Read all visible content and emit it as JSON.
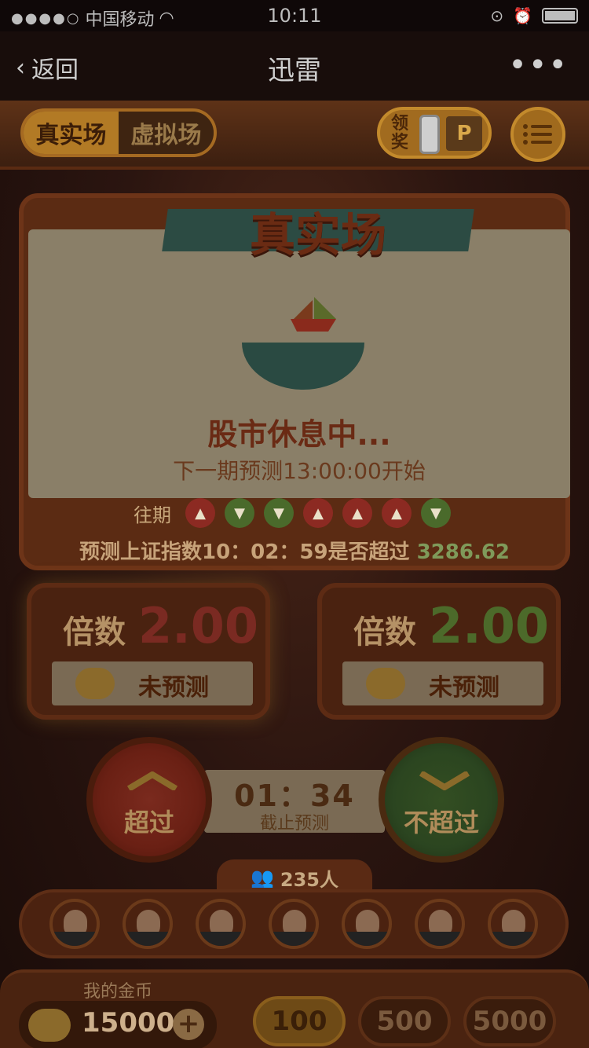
{
  "status_bar": {
    "carrier": "中国移动",
    "time": "10:11"
  },
  "nav": {
    "back_label": "返回",
    "title": "迅雷",
    "more_label": "•••"
  },
  "top_tabs": {
    "real_label": "真实场",
    "virtual_label": "虚拟场",
    "active": "real"
  },
  "award": {
    "label": "领奖"
  },
  "main": {
    "banner_title": "真实场",
    "status": "股市休息中...",
    "next_period": "下一期预测13:00:00开始",
    "history_label": "往期",
    "history": [
      "up",
      "down",
      "down",
      "up",
      "up",
      "up",
      "down"
    ],
    "predict_prefix": "预测上证指数10：02：59是否超过",
    "predict_value": "3286.62"
  },
  "multipliers": {
    "label": "倍数",
    "left_value": "2.00",
    "right_value": "2.00",
    "left_status": "未预测",
    "right_status": "未预测"
  },
  "actions": {
    "up_label": "超过",
    "down_label": "不超过",
    "countdown": "01：34",
    "countdown_label": "截止预测"
  },
  "players": {
    "count": "235人",
    "avatars": [
      "avatar-1",
      "avatar-2",
      "avatar-3",
      "avatar-4",
      "avatar-5",
      "avatar-6",
      "avatar-7"
    ]
  },
  "wallet": {
    "label": "我的金币",
    "coins": "15000",
    "bets": [
      "100",
      "500",
      "5000"
    ],
    "selected_bet": "100"
  },
  "colors": {
    "up": "#8c2a22",
    "down": "#4a6a2b",
    "accent": "#b27a25"
  }
}
